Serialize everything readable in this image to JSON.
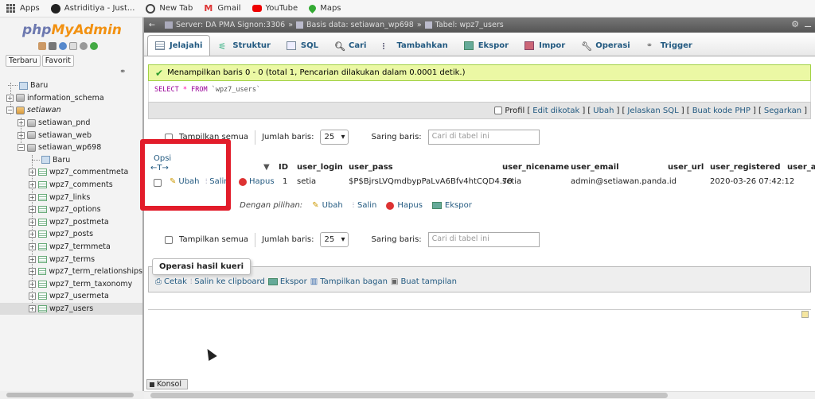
{
  "bookmarks": [
    {
      "label": "Apps",
      "icon": "apps-grid-icon"
    },
    {
      "label": "Astriditiya - Just...",
      "icon": "github-icon"
    },
    {
      "label": "New Tab",
      "icon": "globe-icon"
    },
    {
      "label": "Gmail",
      "icon": "gmail-icon"
    },
    {
      "label": "YouTube",
      "icon": "youtube-icon"
    },
    {
      "label": "Maps",
      "icon": "maps-icon"
    }
  ],
  "sidebar": {
    "logo_php": "php",
    "logo_myadmin": "MyAdmin",
    "tab_recent": "Terbaru",
    "tab_favorite": "Favorit",
    "tree": [
      {
        "label": "Baru",
        "type": "new",
        "level": 0
      },
      {
        "label": "information_schema",
        "type": "db",
        "level": 0
      },
      {
        "label": "setiawan",
        "type": "db-group",
        "level": 0
      },
      {
        "label": "setiawan_pnd",
        "type": "db",
        "level": 1
      },
      {
        "label": "setiawan_web",
        "type": "db",
        "level": 1
      },
      {
        "label": "setiawan_wp698",
        "type": "db",
        "level": 1
      },
      {
        "label": "Baru",
        "type": "new",
        "level": 2
      },
      {
        "label": "wpz7_commentmeta",
        "type": "table",
        "level": 2
      },
      {
        "label": "wpz7_comments",
        "type": "table",
        "level": 2
      },
      {
        "label": "wpz7_links",
        "type": "table",
        "level": 2
      },
      {
        "label": "wpz7_options",
        "type": "table",
        "level": 2
      },
      {
        "label": "wpz7_postmeta",
        "type": "table",
        "level": 2
      },
      {
        "label": "wpz7_posts",
        "type": "table",
        "level": 2
      },
      {
        "label": "wpz7_termmeta",
        "type": "table",
        "level": 2
      },
      {
        "label": "wpz7_terms",
        "type": "table",
        "level": 2
      },
      {
        "label": "wpz7_term_relationships",
        "type": "table",
        "level": 2
      },
      {
        "label": "wpz7_term_taxonomy",
        "type": "table",
        "level": 2
      },
      {
        "label": "wpz7_usermeta",
        "type": "table",
        "level": 2
      },
      {
        "label": "wpz7_users",
        "type": "table",
        "level": 2,
        "selected": true
      }
    ]
  },
  "breadcrumb": {
    "server": "Server: DA PMA Signon:3306",
    "database": "Basis data: setiawan_wp698",
    "table": "Tabel: wpz7_users"
  },
  "tabs": [
    {
      "label": "Jelajahi",
      "icon": "browse-icon",
      "active": true
    },
    {
      "label": "Struktur",
      "icon": "structure-icon"
    },
    {
      "label": "SQL",
      "icon": "sql-icon"
    },
    {
      "label": "Cari",
      "icon": "search-icon"
    },
    {
      "label": "Tambahkan",
      "icon": "insert-icon"
    },
    {
      "label": "Ekspor",
      "icon": "export-icon"
    },
    {
      "label": "Impor",
      "icon": "import-icon"
    },
    {
      "label": "Operasi",
      "icon": "wrench-icon"
    },
    {
      "label": "Trigger",
      "icon": "trigger-icon"
    }
  ],
  "message": "Menampilkan baris 0 - 0 (total 1, Pencarian dilakukan dalam 0.0001 detik.)",
  "sql": {
    "select": "SELECT",
    "star": "*",
    "from": "FROM",
    "table": "`wpz7_users`"
  },
  "sql_links": {
    "profil": "Profil",
    "edit_inline": "Edit dikotak",
    "edit": "Ubah",
    "explain": "Jelaskan SQL",
    "php": "Buat kode PHP",
    "refresh": "Segarkan"
  },
  "navigation": {
    "show_all": "Tampilkan semua",
    "rows_label": "Jumlah baris:",
    "rows_value": "25",
    "filter_label": "Saring baris:",
    "filter_placeholder": "Cari di tabel ini"
  },
  "table": {
    "options_label": "Opsi",
    "columns": [
      "ID",
      "user_login",
      "user_pass",
      "user_nicename",
      "user_email",
      "user_url",
      "user_registered",
      "user_ac"
    ],
    "row": {
      "edit": "Ubah",
      "copy": "Salin",
      "delete": "Hapus",
      "ID": "1",
      "user_login": "setia",
      "user_pass": "$P$BjrsLVQmdbypPaLvA6Bfv4htCQD4.70",
      "user_nicename": "setia",
      "user_email": "admin@setiawan.panda.id",
      "user_url": "",
      "user_registered": "2020-03-26 07:42:12"
    }
  },
  "bulk": {
    "check_all_partial": "a",
    "with_selected": "Dengan pilihan:",
    "edit": "Ubah",
    "copy": "Salin",
    "delete": "Hapus",
    "export": "Ekspor"
  },
  "query_ops": {
    "legend": "Operasi hasil kueri",
    "print": "Cetak",
    "copy_clipboard": "Salin ke clipboard",
    "export": "Ekspor",
    "chart": "Tampilkan bagan",
    "create_view": "Buat tampilan"
  },
  "console": "Konsol",
  "colors": {
    "link": "#235a81",
    "success_bg": "#ebf8a4",
    "highlight": "#e21c2a"
  }
}
